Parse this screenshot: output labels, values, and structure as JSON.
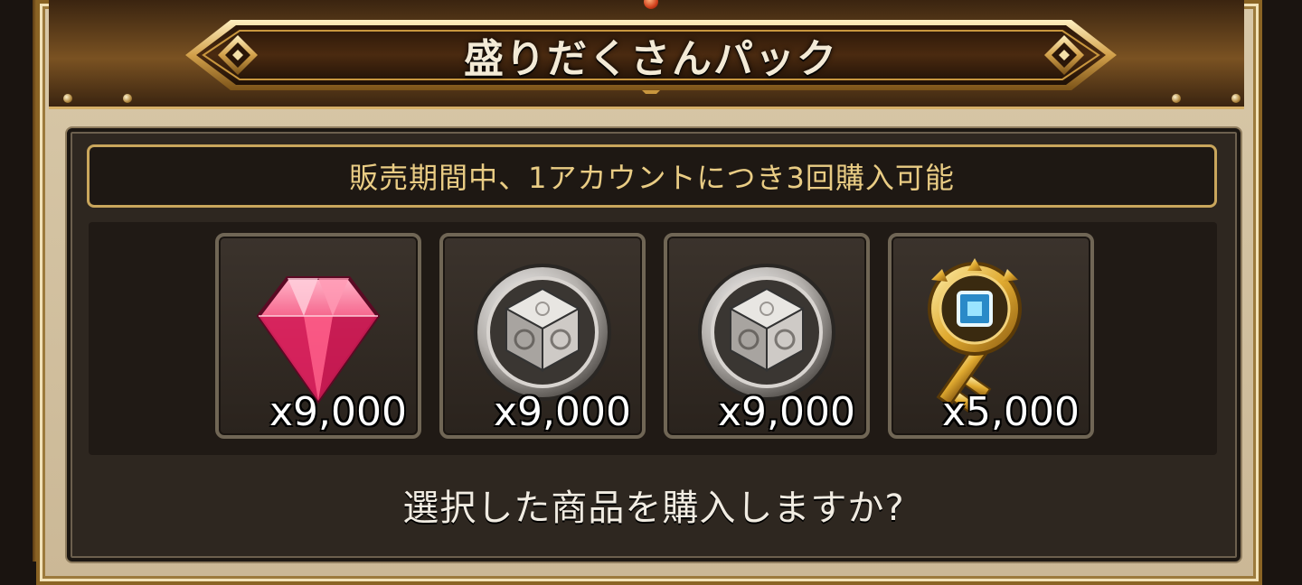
{
  "dialog": {
    "title": "盛りだくさんパック",
    "notice": "販売期間中、1アカウントにつき3回購入可能",
    "question": "選択した商品を購入しますか?"
  },
  "items": [
    {
      "icon": "pink-gem-icon",
      "quantity": "x9,000"
    },
    {
      "icon": "silver-dice-coin-icon",
      "quantity": "x9,000"
    },
    {
      "icon": "silver-dice-coin-icon",
      "quantity": "x9,000"
    },
    {
      "icon": "gold-key-icon",
      "quantity": "x5,000"
    }
  ],
  "colors": {
    "frame_gold": "#c8963e",
    "panel_dark": "#2e2720",
    "notice_text": "#e9cc84",
    "gem_pink": "#e8326a"
  }
}
